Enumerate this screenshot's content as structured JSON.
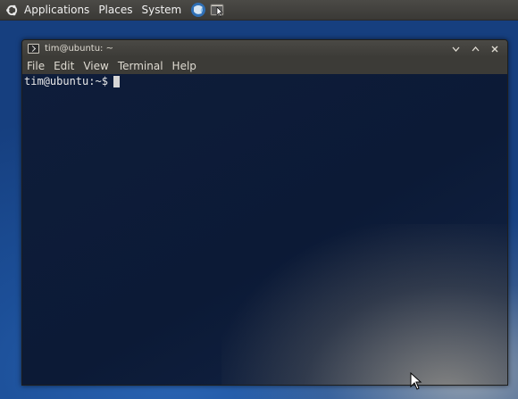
{
  "panel": {
    "menus": [
      "Applications",
      "Places",
      "System"
    ]
  },
  "window": {
    "title": "tim@ubuntu: ~",
    "menubar": [
      "File",
      "Edit",
      "View",
      "Terminal",
      "Help"
    ],
    "controls": [
      "minimize",
      "maximize",
      "close"
    ]
  },
  "terminal": {
    "prompt": "tim@ubuntu:~$"
  },
  "colors": {
    "panel_bg": "#3c3b37",
    "terminal_bg": "#0e1d3a",
    "desktop_bg": "#1c4f98"
  }
}
